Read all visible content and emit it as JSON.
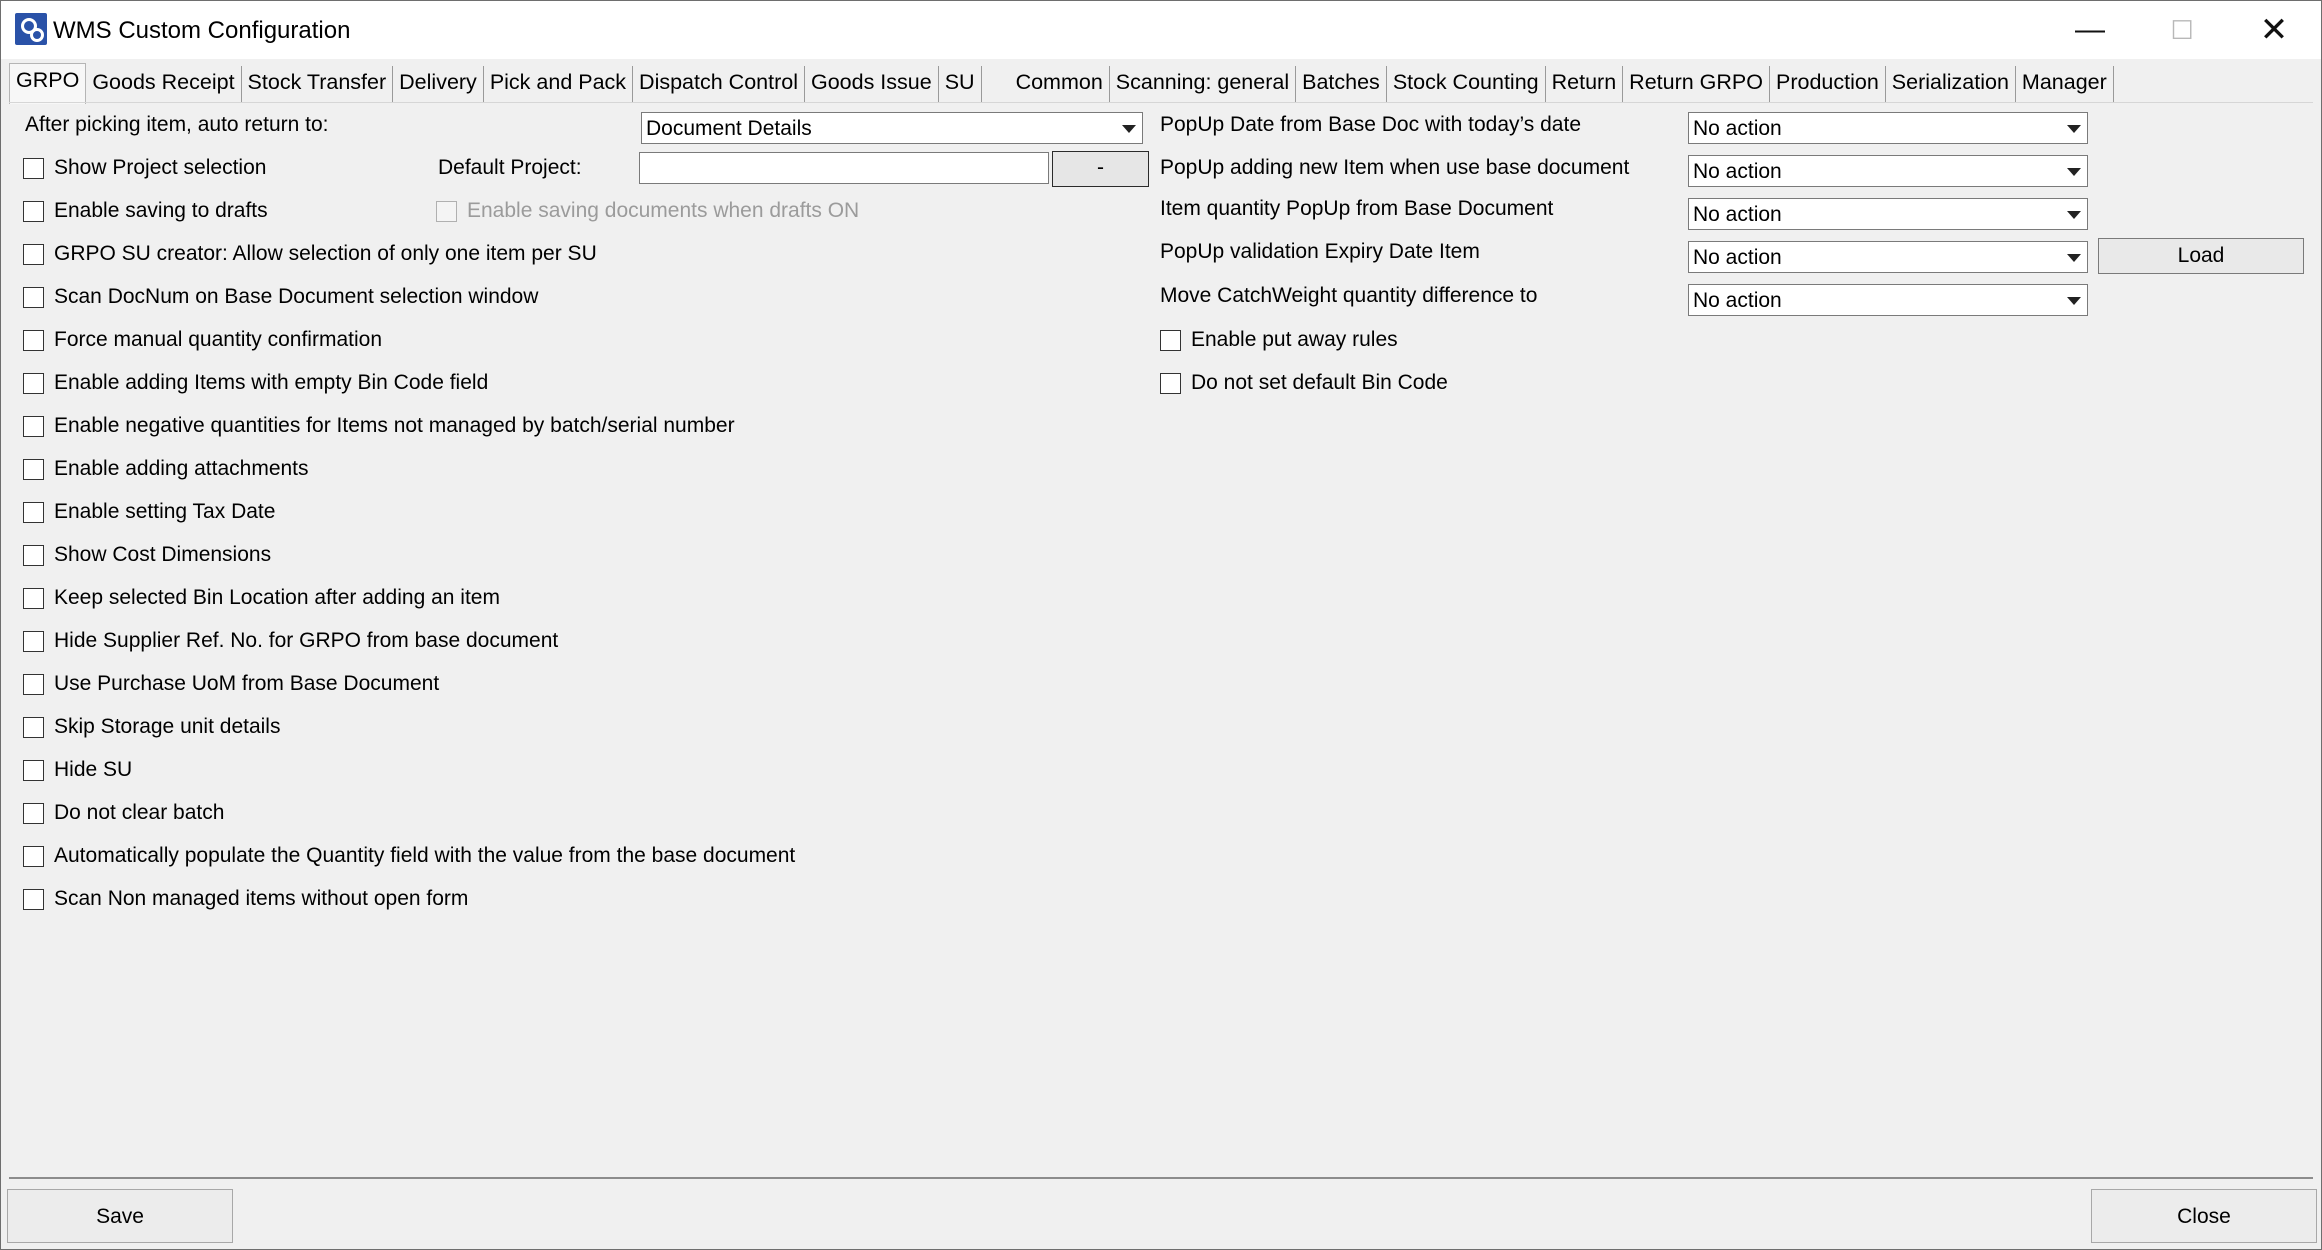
{
  "window": {
    "title": "WMS Custom Configuration",
    "minimize_glyph": "—",
    "maximize_glyph": "☐",
    "close_glyph": "✕",
    "accent_color": "#2a52a8"
  },
  "tabs": [
    {
      "label": "GRPO",
      "active": true
    },
    {
      "label": "Goods Receipt"
    },
    {
      "label": "Stock Transfer"
    },
    {
      "label": "Delivery"
    },
    {
      "label": "Pick and Pack"
    },
    {
      "label": "Dispatch Control"
    },
    {
      "label": "Goods Issue"
    },
    {
      "label": "SU"
    },
    {
      "label": "Common"
    },
    {
      "label": "Scanning: general"
    },
    {
      "label": "Batches"
    },
    {
      "label": "Stock Counting"
    },
    {
      "label": "Return"
    },
    {
      "label": "Return GRPO"
    },
    {
      "label": "Production"
    },
    {
      "label": "Serialization"
    },
    {
      "label": "Manager"
    }
  ],
  "left": {
    "auto_return_label": "After picking item, auto return to:",
    "auto_return_value": "Document Details",
    "default_project_label": "Default Project:",
    "default_project_value": "",
    "default_project_button": "-",
    "drafts_docs_label": "Enable saving documents when drafts ON",
    "checkboxes": [
      "Show Project selection",
      "Enable saving to drafts",
      "GRPO SU creator: Allow selection of only one item per SU",
      "Scan DocNum on Base Document selection window",
      "Force manual quantity confirmation",
      "Enable adding Items with empty Bin Code field",
      "Enable negative quantities for Items not managed by batch/serial number",
      "Enable adding attachments",
      "Enable setting Tax Date",
      "Show Cost Dimensions",
      "Keep selected Bin Location after adding an item",
      "Hide Supplier Ref. No. for GRPO from base document",
      "Use Purchase UoM from Base Document",
      "Skip Storage unit details",
      "Hide SU",
      "Do not clear batch",
      "Automatically populate the Quantity field with the value from the base document",
      "Scan Non managed items without open form"
    ]
  },
  "right": {
    "dropdowns": [
      {
        "label": "PopUp Date from Base Doc with today’s date",
        "value": "No action"
      },
      {
        "label": "PopUp adding new Item when use base document",
        "value": "No action"
      },
      {
        "label": "Item quantity PopUp from Base Document",
        "value": "No action"
      },
      {
        "label": "PopUp validation Expiry Date Item",
        "value": "No action"
      },
      {
        "label": "Move CatchWeight quantity difference to",
        "value": "No action"
      }
    ],
    "load_button": "Load",
    "checkboxes": [
      "Enable put away rules",
      "Do not set default Bin Code"
    ]
  },
  "footer": {
    "save_label": "Save",
    "close_label": "Close"
  }
}
